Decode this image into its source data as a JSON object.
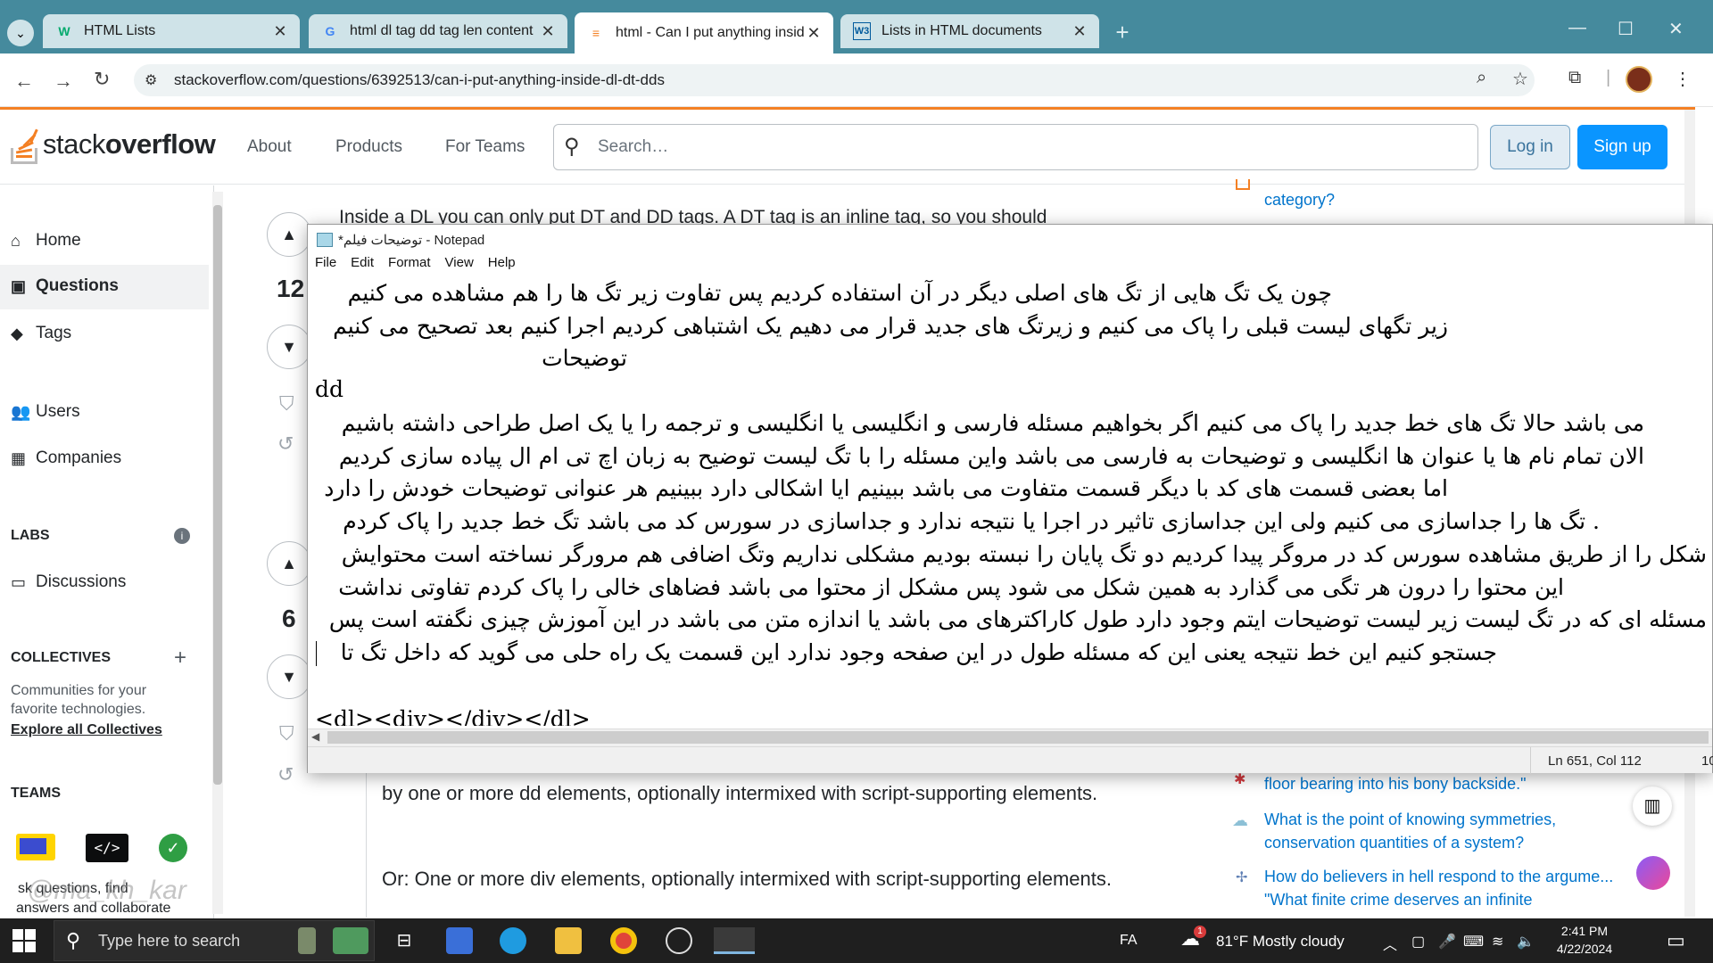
{
  "browser": {
    "tabs": [
      {
        "title": "HTML Lists",
        "favicon": "W"
      },
      {
        "title": "html dl tag dd tag len content",
        "favicon": "G"
      },
      {
        "title": "html - Can I put anything insid",
        "favicon": "SO"
      },
      {
        "title": "Lists in HTML documents",
        "favicon": "W3"
      }
    ],
    "address": "stackoverflow.com/questions/6392513/can-i-put-anything-inside-dl-dt-dds"
  },
  "so": {
    "logo_regular": "stack",
    "logo_bold": "overflow",
    "nav": [
      "About",
      "Products",
      "For Teams"
    ],
    "search_placeholder": "Search…",
    "login": "Log in",
    "signup": "Sign up"
  },
  "leftnav": {
    "home": "Home",
    "questions": "Questions",
    "tags": "Tags",
    "users": "Users",
    "companies": "Companies",
    "labs": "LABS",
    "discussions": "Discussions",
    "collectives": "COLLECTIVES",
    "collectives_desc": "Communities for your favorite technologies.",
    "explore": "Explore all Collectives",
    "teams": "TEAMS",
    "teams_desc_1": "sk questions, find",
    "teams_desc_2": "answers and collaborate"
  },
  "main": {
    "vote1": "12",
    "vote2": "6",
    "peek": "Inside a  DL  you can only put  DT  and  DD  tags. A  DT  tag is an inline tag, so you should",
    "p1": "by one or more dd elements, optionally intermixed with script-supporting elements.",
    "p2": "Or: One or more div elements, optionally intermixed with script-supporting elements."
  },
  "sidebar": {
    "top": "category?",
    "item1": "floor bearing into his bony backside.\"",
    "item2": "What is the point of knowing symmetries, conservation quantities of a system?",
    "item3a": "How do believers in hell respond to the argume...",
    "item3b": "\"What finite crime deserves an infinite"
  },
  "notepad": {
    "title": "*توضیحات فیلم - Notepad",
    "menu": [
      "File",
      "Edit",
      "Format",
      "View",
      "Help"
    ],
    "lines": [
      "چون یک تگ هایی از تگ های اصلی دیگر در آن استفاده کردیم پس تفاوت زیر تگ ها را هم مشاهده می کنیم",
      "زیر تگهای لیست قبلی را پاک می کنیم و زیرتگ های جدید قرار می دهیم  یک اشتباهی کردیم اجرا کنیم بعد تصحیح می کنیم",
      "توضیحات",
      "dd",
      "می باشد  حالا تگ های خط جدید را پاک می کنیم اگر بخواهیم مسئله فارسی و انگلیسی یا انگلیسی و ترجمه را یا یک اصل طراحی داشته باشیم",
      "الان تمام نام ها یا عنوان ها انگلیسی و توضیحات به فارسی می باشد واین مسئله را با تگ لیست توضیح به زبان اچ تی ام ال پیاده سازی کردیم",
      "اما بعضی قسمت های کد با دیگر قسمت متفاوت می باشد ببینیم ایا اشکالی دارد  ببینیم هر عنوانی توضیحات خودش را دارد",
      ". تگ ها را جداسازی می کنیم ولی این جداسازی تاثیر در اجرا یا نتیجه ندارد و جداسازی در سورس کد می باشد تگ خط جدید را پاک کردم",
      "شکل را از طریق مشاهده سورس کد در مروگر پیدا کردیم دو تگ پایان را نبسته بودیم مشکلی نداریم وتگ اضافی هم مرورگر نساخته است محتوایش",
      "این محتوا را درون هر تگی می گذارد به همین شکل می شود پس مشکل از محتوا می باشد فضاهای خالی را پاک کردم تفاوتی نداشت",
      "مسئله ای که در تگ لیست زیر لیست توضیحات ایتم وجود دارد طول کاراکترهای می باشد  یا اندازه متن می باشد در این آموزش چیزی نگفته است پس",
      "جستجو کنیم  این خط نتیجه یعنی این که مسئله طول در این صفحه وجود ندارد  این قسمت یک راه حلی می گوید که داخل تگ تا",
      "<dl><div></div></dl>"
    ],
    "status_pos": "Ln 651, Col 112",
    "status_zoom": "10"
  },
  "taskbar": {
    "search_placeholder": "Type here to search",
    "lang": "FA",
    "weather": "81°F  Mostly cloudy",
    "weather_badge": "1",
    "time": "2:41 PM",
    "date": "4/22/2024"
  },
  "watermark": "@ma_kh_kar",
  "colors": {
    "tabbar": "#458a9d",
    "so_orange": "#f48024",
    "so_blue": "#0a95ff",
    "link": "#0074cc"
  }
}
